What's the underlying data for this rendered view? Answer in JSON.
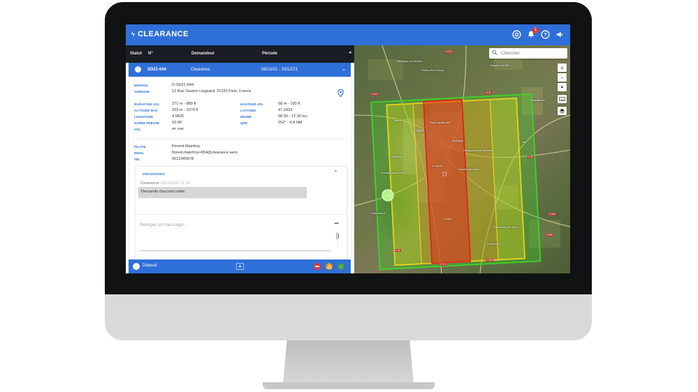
{
  "app": {
    "title": "CLEARANCE",
    "notification_count": "1"
  },
  "icons": {
    "brand": "lightning-icon",
    "account": "account-circle-icon",
    "notifications": "bell-icon",
    "help": "help-circle-icon",
    "announce": "megaphone-icon"
  },
  "table": {
    "headers": {
      "status": "Statut",
      "number": "N°",
      "requester": "Demandeur",
      "period": "Période"
    },
    "selected_row": {
      "number": "SD21-044",
      "requester": "Clearance",
      "period": "09/12/21 - 10/12/21"
    }
  },
  "detail": {
    "mission_label": "MISSION",
    "mission": "D-SD21-044",
    "address_label": "ADRESSE",
    "address": "12 Rue Gaston Liegeard, 21220 Fixin, France",
    "elevation_label": "ÉLÉVATION SOL",
    "elevation": "271 m - 889 ft",
    "altitude_label": "ALTITUDE MAX",
    "altitude": "329 m - 1079 ft",
    "longitude_label": "LONGITUDE",
    "longitude": "4.9825",
    "duration_label": "DUREE PREVUE",
    "duration": "02:00",
    "flight_label": "VOL",
    "flight": "en vue",
    "height_label": "HAUTEUR VOL",
    "height": "58 m - 190 ft",
    "latitude_label": "LATITUDE",
    "latitude": "47.2433",
    "hour_label": "HEURE",
    "hour": "08:30 - 12:30 loc.",
    "qdr_label": "QDR",
    "qdr": "252° - 4.8 NM",
    "pilot_label": "PILOTE",
    "pilot": "Florent Mainfroy",
    "email_label": "EMAIL",
    "email": "florent.mainfroy+654@clearance.aero",
    "phone_label": "TÉL",
    "phone": "0612345678"
  },
  "discussions": {
    "title": "DISCUSSIONS",
    "author": "Clearance",
    "timestamp": "29/11/2021 11:14",
    "message": "Demande d'accord créée.",
    "compose_placeholder": "Rédiger un message..."
  },
  "footer": {
    "status": "Déposé"
  },
  "map": {
    "search_placeholder": "Chercher",
    "zoom_in": "+",
    "zoom_out": "−",
    "towns": [
      "Messigny-et-Vantoux",
      "Talant",
      "Dijon",
      "Saint-Apollinaire",
      "Quetigny",
      "Chevigny-Saint-Sauveur",
      "Chenôve",
      "Marsannay-la-Côte",
      "Longvic",
      "Neuilly-lès-Dijon",
      "Chambœuf",
      "Bellenfeuve",
      "Izier",
      "Magny-sur-Tille",
      "Fauverney",
      "Ruffey-lès-Echirey",
      "Ouges",
      "Sennecey-lès-Dijon"
    ],
    "roads": [
      "A 311",
      "N 274",
      "A 31",
      "A 38",
      "D 974",
      "D 968",
      "D 996",
      "A 36",
      "D 905"
    ],
    "zone_colors": {
      "outer": "#3cd626",
      "mid": "#e6d51c",
      "core": "#e2231e"
    }
  }
}
